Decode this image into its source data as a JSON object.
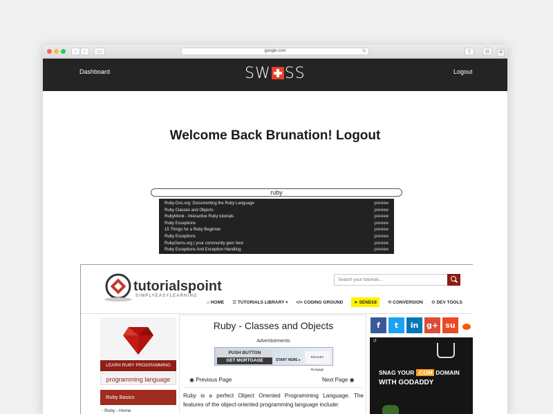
{
  "browser": {
    "url": "google.com",
    "back_glyph": "‹",
    "forward_glyph": "›",
    "sidebar_glyph": "▭",
    "reload_glyph": "↻",
    "share_glyph": "⇪",
    "tabs_glyph": "⧉",
    "new_tab_glyph": "+"
  },
  "header": {
    "left_link": "Dashboard",
    "logo_left": "SW",
    "logo_right": "SS",
    "right_link": "Logout",
    "brand_color": "#e8412c"
  },
  "welcome": "Welcome Back Brunation! Logout",
  "search": {
    "value": "ruby"
  },
  "results": [
    {
      "title": "Ruby-Doc.org: Documenting the Ruby Language",
      "action": "preview"
    },
    {
      "title": "Ruby Classes and Objects",
      "action": "preview"
    },
    {
      "title": "RubyMonk - Interactive Ruby tutorials",
      "action": "preview"
    },
    {
      "title": "Ruby Exceptions",
      "action": "preview"
    },
    {
      "title": "15 Things for a Ruby Beginner",
      "action": "preview"
    },
    {
      "title": "Ruby Exceptions",
      "action": "preview"
    },
    {
      "title": "RubyGems.org | your community gem host",
      "action": "preview"
    },
    {
      "title": "Ruby Exceptions And Exception Handling",
      "action": "preview"
    }
  ],
  "preview": {
    "logo_main": "tutorialspoint",
    "logo_sub": "SIMPLYEASYLEARNING",
    "search_placeholder": "Search your tutorials...",
    "menu": [
      {
        "icon": "home-icon",
        "glyph": "⌂",
        "label": "HOME"
      },
      {
        "icon": "library-icon",
        "glyph": "☰",
        "label": "TUTORIALS LIBRARY ▾"
      },
      {
        "icon": "code-icon",
        "glyph": "</>",
        "label": "CODING GROUND"
      },
      {
        "icon": "send-icon",
        "glyph": "➤",
        "label": "SEND18"
      },
      {
        "icon": "conversion-icon",
        "glyph": "⟲",
        "label": "CONVERSION"
      },
      {
        "icon": "tools-icon",
        "glyph": "⚙",
        "label": "DEV TOOLS"
      }
    ],
    "sidebar": {
      "learn": "LEARN RUBY PROGRAMMING",
      "lang": "programming language",
      "section": "Ruby Basics",
      "first_item": "Ruby - Home"
    },
    "page_title": "Ruby - Classes and Objects",
    "ads_label": "Advertisements",
    "ad": {
      "line1": "PUSH BUTTON",
      "line2": "GET MORTGAGE",
      "cta": "START HERE ▸",
      "brand": "ROCKET Mortgage"
    },
    "prev_page": "◉ Previous Page",
    "next_page": "Next Page ◉",
    "intro": "Ruby is a perfect Object Oriented Programming Language. The features of the object-oriented programming language include:",
    "social": [
      {
        "name": "facebook-icon",
        "glyph": "f",
        "color": "#3b5998"
      },
      {
        "name": "twitter-icon",
        "glyph": "t",
        "color": "#1da1f2"
      },
      {
        "name": "linkedin-icon",
        "glyph": "in",
        "color": "#0077b5"
      },
      {
        "name": "google-plus-icon",
        "glyph": "g+",
        "color": "#dd4b39"
      },
      {
        "name": "stumbleupon-icon",
        "glyph": "su",
        "color": "#eb4924"
      }
    ],
    "godaddy": {
      "refresh": "↺",
      "line1_a": "SNAG YOUR ",
      "line1_b": ".COM",
      "line1_c": " DOMAIN",
      "line2": "WITH GODADDY"
    }
  }
}
